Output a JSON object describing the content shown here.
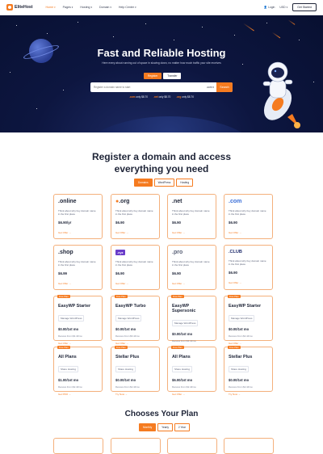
{
  "nav": {
    "brand": "EliteHost",
    "menu": [
      {
        "label": "Home",
        "active": true
      },
      {
        "label": "Pages",
        "active": false
      },
      {
        "label": "Hosting",
        "active": false
      },
      {
        "label": "Domain",
        "active": false
      },
      {
        "label": "Help Center",
        "active": false
      }
    ],
    "login": "Login",
    "currency": "USD",
    "get_started": "Get Started"
  },
  "hero": {
    "title": "Fast and Reliable Hosting",
    "subtitle": "Here every about running out of space in slowing down, no matter how much traffic your site receives",
    "tab_register": "Register",
    "tab_transfer": "Transfer",
    "search_placeholder": "Register a domain name to start",
    "search_tld": ".com",
    "search_button": "Search",
    "tld_prices": [
      {
        "tld": ".com",
        "price": "only $8.70"
      },
      {
        "tld": ".net",
        "price": "only $8.70"
      },
      {
        "tld": ".org",
        "price": "only $8.70"
      }
    ]
  },
  "domains": {
    "title_line1": "Register a domain and access",
    "title_line2": "everything you need",
    "tabs": [
      "Domains",
      "WordPress",
      "Hosting"
    ],
    "active_tab": "Domains",
    "cards": [
      {
        "name": ".online",
        "desc": "Think about why buy domain name in the first place",
        "price": "$6.90/yr",
        "cta": "Get Offer"
      },
      {
        "name": ".org",
        "desc": "Think about why buy domain name in the first place",
        "price": "$6.90",
        "cta": "Get Offer"
      },
      {
        "name": ".net",
        "desc": "Think about why buy domain name in the first place",
        "price": "$6.90",
        "cta": "Get Offer"
      },
      {
        "name": ".com",
        "desc": "Think about why buy domain name in the first place",
        "price": "$6.90",
        "cta": "Get Offer"
      },
      {
        "name": ".shop",
        "desc": "Think about why buy domain name in the first place",
        "price": "$6.99",
        "cta": "Get Offer"
      },
      {
        "name": ".xyz",
        "desc": "Think about why buy domain name in the first place",
        "price": "$6.90",
        "cta": "Get Offer"
      },
      {
        "name": ".pro",
        "desc": "Think about why buy domain name in the first place",
        "price": "$6.90",
        "cta": "Get Offer"
      },
      {
        "name": ".CLUB",
        "desc": "Think about why buy domain name in the first place",
        "price": "$6.90",
        "cta": "Get Offer"
      }
    ],
    "wp_cards": [
      {
        "badge": "Free Plan",
        "name": "EasyWP Starter",
        "sub": "Manage WordPress",
        "price": "$0.00/1st mo",
        "renew": "Renews From  $4.44/mo",
        "cta": "Get Offer"
      },
      {
        "badge": "Free Plan",
        "name": "EasyWP Turbo",
        "sub": "Manage WordPress",
        "price": "$0.00/1st mo",
        "renew": "Renews From  $6.44/mo",
        "cta": "Get Offer"
      },
      {
        "badge": "Free Plan",
        "name": "EasyWP Supersonic",
        "sub": "Manage WordPress",
        "price": "$0.00/1st mo",
        "renew": "Renews From  $4.44/mo",
        "cta": "Get Offer"
      },
      {
        "badge": "Free Plan",
        "name": "EasyWP Starter",
        "sub": "Manage WordPress",
        "price": "$0.00/1st mo",
        "renew": "Renews From  $4.44/mo",
        "cta": "Get Offer"
      }
    ],
    "host_cards": [
      {
        "badge": "Free Plan",
        "name": "All Plans",
        "sub": "Share Hosting",
        "price": "$1.00/1st mo",
        "renew": "Renews From  $2.44/mo",
        "cta": "Get PRO"
      },
      {
        "badge": "Free Plan",
        "name": "Stellar Plus",
        "sub": "Share Hosting",
        "price": "$0.00/1st mo",
        "renew": "Renews From  $2.44/mo",
        "cta": "Try Now"
      },
      {
        "badge": "Free Plan",
        "name": "All Plans",
        "sub": "Share Hosting",
        "price": "$6.00/1st mo",
        "renew": "Renews From  $2.44/mo",
        "cta": "Get Offer"
      },
      {
        "badge": "Free Plan",
        "name": "Stellar Plus",
        "sub": "Share Hosting",
        "price": "$0.00/1st mo",
        "renew": "Renews From  $2.44/mo",
        "cta": "Try Now"
      }
    ]
  },
  "plans": {
    "title": "Chooses Your Plan",
    "tabs": [
      "Monthly",
      "Yearly",
      "2 Year"
    ],
    "active_tab": "Monthly"
  },
  "colors": {
    "accent": "#f57b20",
    "navy": "#0d1640",
    "text": "#1e2437"
  }
}
